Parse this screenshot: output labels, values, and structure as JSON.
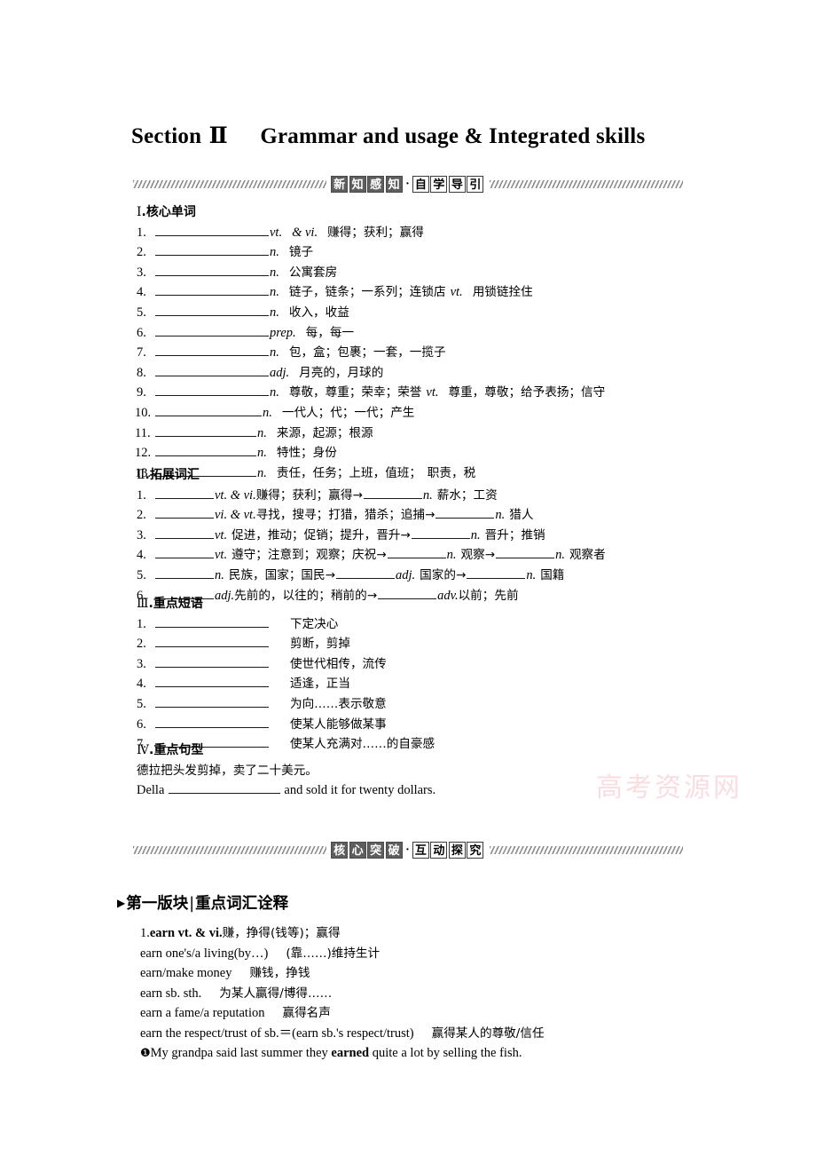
{
  "document": {
    "title_prefix": "Section",
    "section_number": "Ⅱ",
    "title_main": "Grammar and usage & Integrated skills",
    "watermark": "高考资源网"
  },
  "banner1": {
    "dark_chars": [
      "新",
      "知",
      "感",
      "知"
    ],
    "separator": "·",
    "light_chars": [
      "自",
      "学",
      "导",
      "引"
    ]
  },
  "banner2": {
    "dark_chars": [
      "核",
      "心",
      "突",
      "破"
    ],
    "separator": "·",
    "light_chars": [
      "互",
      "动",
      "探",
      "究"
    ]
  },
  "core_words": {
    "heading_numeral": "Ⅰ",
    "heading_text": ".核心单词",
    "items": [
      {
        "n": "1.",
        "pos": "vt.",
        "pos2": "& vi.",
        "meaning": "赚得；获利；赢得"
      },
      {
        "n": "2.",
        "pos": "n.",
        "pos2": "",
        "meaning": "镜子"
      },
      {
        "n": "3.",
        "pos": "n.",
        "pos2": "",
        "meaning": "公寓套房"
      },
      {
        "n": "4.",
        "pos": "n.",
        "pos2": "",
        "meaning": "链子，链条；一系列；连锁店",
        "pos3": "vt.",
        "meaning2": "用锁链拴住"
      },
      {
        "n": "5.",
        "pos": "n.",
        "pos2": "",
        "meaning": "收入，收益"
      },
      {
        "n": "6.",
        "pos": "prep.",
        "pos2": "",
        "meaning": "每，每一"
      },
      {
        "n": "7.",
        "pos": "n.",
        "pos2": "",
        "meaning": "包，盒；包裹；一套，一揽子"
      },
      {
        "n": "8.",
        "pos": "adj.",
        "pos2": "",
        "meaning": "月亮的，月球的"
      },
      {
        "n": "9.",
        "pos": "n.",
        "pos2": "",
        "meaning": "尊敬，尊重；荣幸；荣誉",
        "pos3": "vt.",
        "meaning2": "尊重，尊敬；给予表扬；信守"
      },
      {
        "n": "10.",
        "pos": "n.",
        "pos2": "",
        "meaning": "一代人；代；一代；产生"
      },
      {
        "n": "11.",
        "pos": "n.",
        "pos2": "",
        "meaning": "来源，起源；根源"
      },
      {
        "n": "12.",
        "pos": "n.",
        "pos2": "",
        "meaning": "特性；身份"
      },
      {
        "n": "13.",
        "pos": "n.",
        "pos2": "",
        "meaning": "责任，任务；上班，值班；　职责，税"
      }
    ]
  },
  "extended_words": {
    "heading_numeral": "Ⅱ",
    "heading_text": ".拓展词汇",
    "items": [
      {
        "n": "1.",
        "pos1": "vt. & vi.",
        "meaning1": "赚得；获利；赢得",
        "arrow": "→",
        "pos2": "n.",
        "meaning2": "薪水；工资"
      },
      {
        "n": "2.",
        "pos1": "vi.  & vt.",
        "meaning1": "寻找，搜寻；打猎，猎杀；追捕",
        "arrow": "→",
        "pos2": "n.",
        "meaning2": "猎人"
      },
      {
        "n": "3.",
        "pos1": "vt.",
        "meaning1": "促进，推动；促销；提升，晋升",
        "arrow": "→",
        "pos2": "n.",
        "meaning2": "晋升；推销"
      },
      {
        "n": "4.",
        "pos1": "vt.",
        "meaning1": "遵守；注意到；观察；庆祝",
        "arrow": "→",
        "pos2": "n.",
        "meaning2": "观察",
        "arrow2": "→",
        "pos3": "n.",
        "meaning3": "观察者"
      },
      {
        "n": "5.",
        "pos1": "n.",
        "meaning1": "民族，国家；国民",
        "arrow": "→",
        "pos2": "adj.",
        "meaning2": "国家的",
        "arrow2": "→",
        "pos3": "n.",
        "meaning3": "国籍"
      },
      {
        "n": "6.",
        "pos1": "adj.",
        "meaning1": "先前的，以往的；稍前的",
        "arrow": "→",
        "pos2": "adv.",
        "meaning2": "以前；先前"
      }
    ]
  },
  "key_phrases": {
    "heading_numeral": "Ⅲ",
    "heading_text": ".重点短语",
    "items": [
      {
        "n": "1.",
        "meaning": "下定决心"
      },
      {
        "n": "2.",
        "meaning": "剪断，剪掉"
      },
      {
        "n": "3.",
        "meaning": "使世代相传，流传"
      },
      {
        "n": "4.",
        "meaning": "适逢，正当"
      },
      {
        "n": "5.",
        "meaning": "为向……表示敬意"
      },
      {
        "n": "6.",
        "meaning": "使某人能够做某事"
      },
      {
        "n": "7.",
        "meaning": "使某人充满对……的自豪感"
      }
    ]
  },
  "key_sentences": {
    "heading_numeral": "Ⅳ",
    "heading_text": ".重点句型",
    "chinese": "德拉把头发剪掉，卖了二十美元。",
    "english_before": "Della",
    "english_after": "and sold it for twenty dollars."
  },
  "module1": {
    "triangle": "▶",
    "label": "第一版块",
    "divider": "|",
    "sublabel": "重点词汇诠释"
  },
  "earn_entry": {
    "lines": [
      {
        "index": "1.",
        "head_bold": "earn vt. & vi.",
        "rest": "赚，挣得(钱等)；赢得"
      },
      {
        "en": "earn one's/a living(by…)",
        "gap": "  ",
        "cn": "(靠……)维持生计"
      },
      {
        "en": "earn/make money",
        "gap": "   ",
        "cn": "赚钱，挣钱"
      },
      {
        "en": "earn sb. sth.",
        "gap": "  ",
        "cn": "为某人赢得/博得……"
      },
      {
        "en": "earn a fame/a reputation",
        "gap": "  ",
        "cn": "赢得名声"
      },
      {
        "en": "earn the respect/trust of sb.＝(earn sb.'s respect/trust)",
        "gap": "  ",
        "cn": "赢得某人的尊敬/信任"
      }
    ],
    "example": {
      "marker": "❶",
      "before": "My grandpa said last summer they ",
      "bold": "earned",
      "after": " quite a lot by selling the fish."
    }
  }
}
